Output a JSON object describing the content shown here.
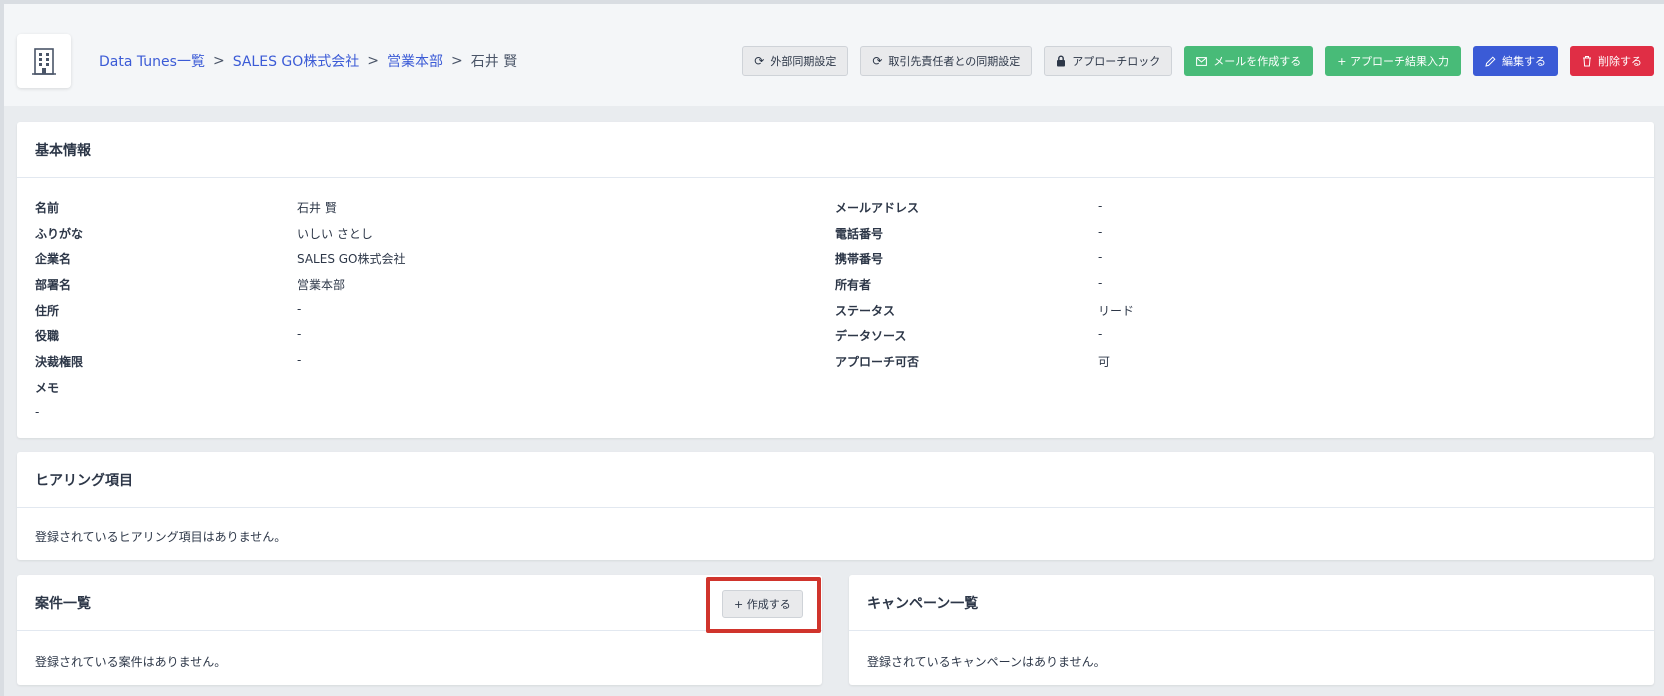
{
  "header": {
    "breadcrumb": [
      {
        "label": "Data Tunes一覧",
        "link": true
      },
      {
        "label": "SALES GO株式会社",
        "link": true
      },
      {
        "label": "営業本部",
        "link": true
      },
      {
        "label": "石井 賢",
        "link": false
      }
    ],
    "separator": ">",
    "buttons": {
      "external_sync": "外部同期設定",
      "contact_sync": "取引先責任者との同期設定",
      "approach_lock": "アプローチロック",
      "create_mail": "メールを作成する",
      "approach_result": "+ アプローチ結果入力",
      "edit": "編集する",
      "delete": "削除する"
    }
  },
  "basic_info": {
    "title": "基本情報",
    "left": [
      {
        "label": "名前",
        "value": "石井 賢"
      },
      {
        "label": "ふりがな",
        "value": "いしい さとし"
      },
      {
        "label": "企業名",
        "value": "SALES GO株式会社"
      },
      {
        "label": "部署名",
        "value": "営業本部"
      },
      {
        "label": "住所",
        "value": "-"
      },
      {
        "label": "役職",
        "value": "-"
      },
      {
        "label": "決裁権限",
        "value": "-"
      }
    ],
    "right": [
      {
        "label": "メールアドレス",
        "value": "-"
      },
      {
        "label": "電話番号",
        "value": "-"
      },
      {
        "label": "携帯番号",
        "value": "-"
      },
      {
        "label": "所有者",
        "value": "-"
      },
      {
        "label": "ステータス",
        "value": "リード"
      },
      {
        "label": "データソース",
        "value": "-"
      },
      {
        "label": "アプローチ可否",
        "value": "可"
      }
    ],
    "memo_label": "メモ",
    "memo_value": "-"
  },
  "hearing": {
    "title": "ヒアリング項目",
    "empty": "登録されているヒアリング項目はありません。"
  },
  "deals": {
    "title": "案件一覧",
    "create_label": "+ 作成する",
    "empty": "登録されている案件はありません。"
  },
  "campaigns": {
    "title": "キャンペーン一覧",
    "empty": "登録されているキャンペーンはありません。"
  },
  "colors": {
    "accent_blue": "#3b5bd6",
    "green": "#48bb78",
    "red": "#e02e45",
    "highlight": "#d0342c"
  }
}
